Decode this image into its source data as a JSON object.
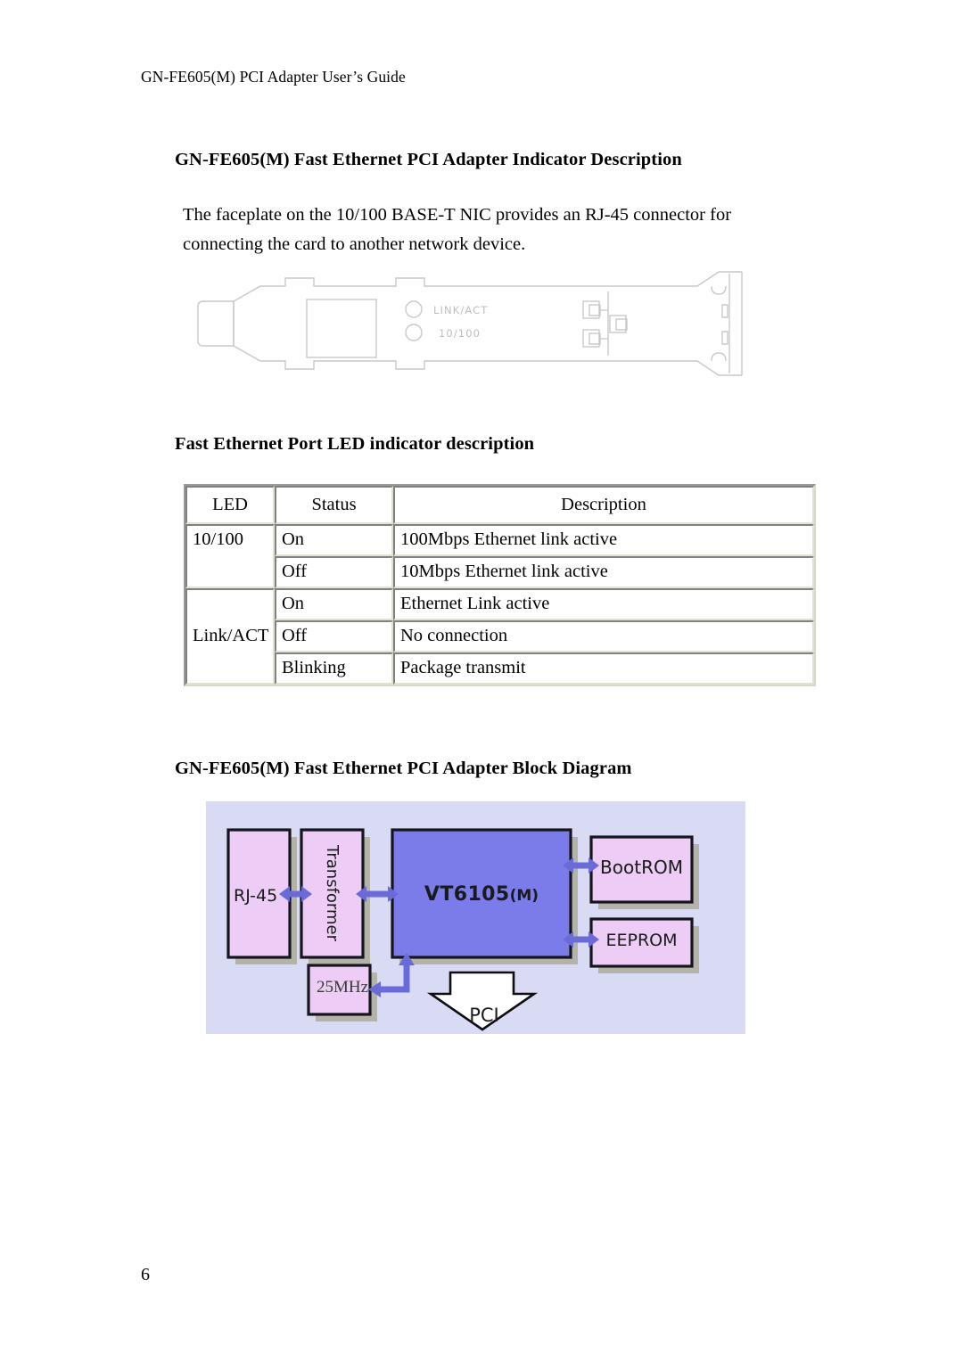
{
  "document": {
    "running_header": "GN-FE605(M) PCI Adapter User’s Guide",
    "page_number": "6"
  },
  "sections": {
    "indicator": {
      "heading": "GN-FE605(M) Fast Ethernet PCI Adapter Indicator Description",
      "paragraph_line1": "The faceplate on the 10/100 BASE-T NIC provides an RJ-45 connector for",
      "paragraph_line2": "connecting the card to another network device."
    },
    "led_table": {
      "heading": "Fast Ethernet Port LED indicator description",
      "columns": [
        "LED",
        "Status",
        "Description"
      ],
      "groups": [
        {
          "led": "10/100",
          "rows": [
            {
              "status": "On",
              "description": "100Mbps Ethernet link active"
            },
            {
              "status": "Off",
              "description": "10Mbps Ethernet link active"
            }
          ]
        },
        {
          "led": "Link/ACT",
          "rows": [
            {
              "status": "On",
              "description": "Ethernet Link active"
            },
            {
              "status": "Off",
              "description": "No connection"
            },
            {
              "status": "Blinking",
              "description": "Package transmit"
            }
          ]
        }
      ]
    },
    "block_diagram": {
      "heading": "GN-FE605(M) Fast Ethernet PCI Adapter Block Diagram",
      "blocks": {
        "rj45": "RJ-45",
        "transformer": "Transformer",
        "chip_main": "VT6105",
        "chip_suffix": "(M)",
        "bootrom": "BootROM",
        "eeprom": "EEPROM",
        "oscillator": "25MHz",
        "bus": "PCI"
      },
      "colors": {
        "background": "#d9dbf5",
        "block_fill": "#edcdf5",
        "chip_fill": "#7b7bea",
        "shadow": "#b3b3a8",
        "arrow": "#6b6bd8",
        "outline": "#15151e",
        "bus_arrow_fill": "#ffffff"
      }
    }
  },
  "faceplate": {
    "led_labels": [
      "LINK/ACT",
      "10/100"
    ],
    "stroke_color": "#c9c9c9"
  }
}
